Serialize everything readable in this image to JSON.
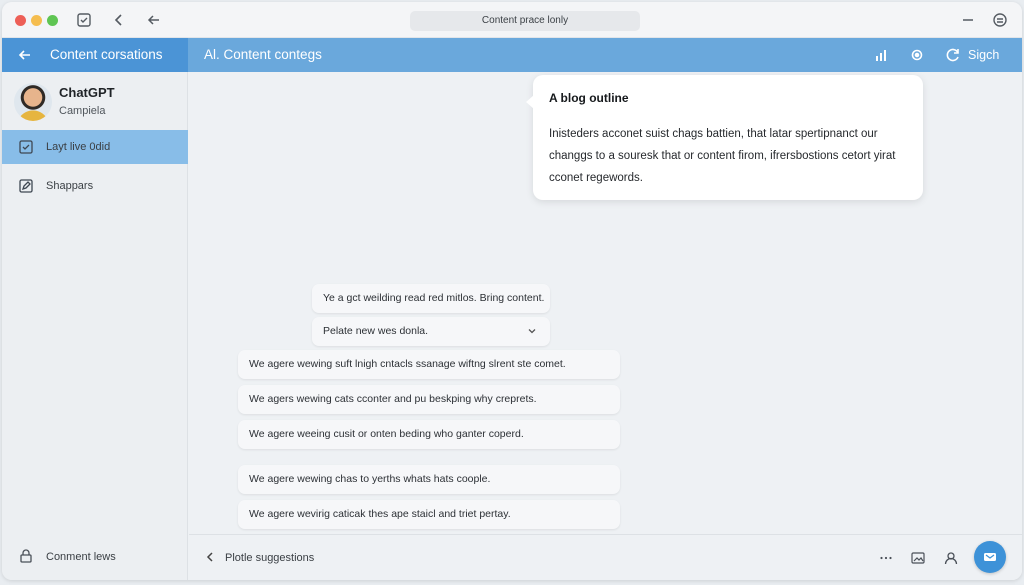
{
  "titlebar": {
    "url_text": "Content prace lonly",
    "icons": [
      "compose-icon",
      "chevron-left-icon",
      "back-arrow-icon",
      "minimize-icon",
      "account-icon"
    ]
  },
  "header": {
    "left_title": "Content corsations",
    "main_title": "Al. Content contegs",
    "sign_label": "Sigch",
    "icons": [
      "back-arrow-icon",
      "chart-icon",
      "settings-icon",
      "refresh-icon"
    ],
    "colors": {
      "header": "#6aa8dc",
      "header_left": "#4b94d6"
    }
  },
  "sidebar": {
    "user": {
      "name": "ChatGPT",
      "subtitle": "Campiela"
    },
    "items": [
      {
        "label": "Layt live 0did",
        "icon": "checkbox-icon",
        "active": true
      },
      {
        "label": "Shappars",
        "icon": "edit-icon",
        "active": false
      }
    ],
    "footer": {
      "label": "Conment lews",
      "icon": "lock-icon"
    },
    "colors": {
      "active": "#88bde8"
    }
  },
  "main": {
    "bubble": {
      "title": "A blog outline",
      "body": "Inisteders acconet suist chags battien, that latar spertipnanct our changgs to a souresk that or content firom, ifrersbostions cetort yirat cconet regewords."
    },
    "suggestions": [
      {
        "text": "Ye a gct weilding read red mitlos. Bring content."
      },
      {
        "text": "Pelate new wes donla.",
        "dropdown": true
      },
      {
        "text": "We agere wewing suft lnigh cntacls ssanage wiftng slrent ste comet."
      },
      {
        "text": "We agers wewing cats cconter and pu beskping why creprets."
      },
      {
        "text": "We agere weeing cusit or onten beding who ganter coperd."
      },
      {
        "text": "We agere wewing chas to yerths whats hats coople."
      },
      {
        "text": "We agere wevirig caticak thes ape staicl and triet pertay."
      }
    ]
  },
  "bottombar": {
    "label": "Plotle suggestions",
    "icons": [
      "more-icon",
      "image-icon",
      "person-icon",
      "send-icon"
    ],
    "colors": {
      "fab": "#3d92d8"
    }
  }
}
